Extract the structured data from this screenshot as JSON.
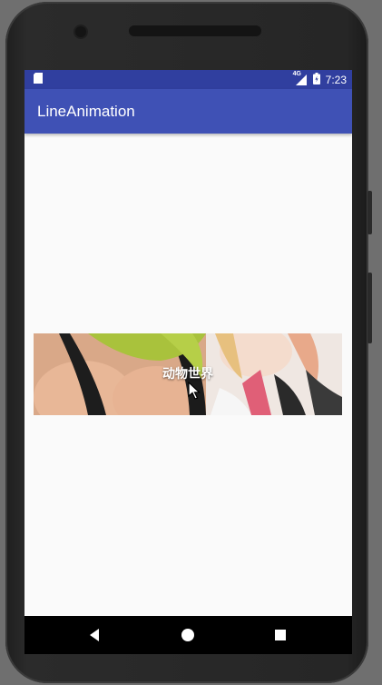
{
  "status_bar": {
    "time": "7:23",
    "network_label": "4G",
    "icons": [
      "sd-card-icon",
      "signal-icon",
      "battery-icon"
    ]
  },
  "app_bar": {
    "title": "LineAnimation"
  },
  "banner": {
    "caption": "动物世界"
  },
  "nav_bar": {
    "buttons": [
      "back-icon",
      "home-icon",
      "recents-icon"
    ]
  },
  "colors": {
    "status_bar": "#303f9f",
    "app_bar": "#3f51b5",
    "content_bg": "#fafafa",
    "nav_bar": "#000000"
  }
}
